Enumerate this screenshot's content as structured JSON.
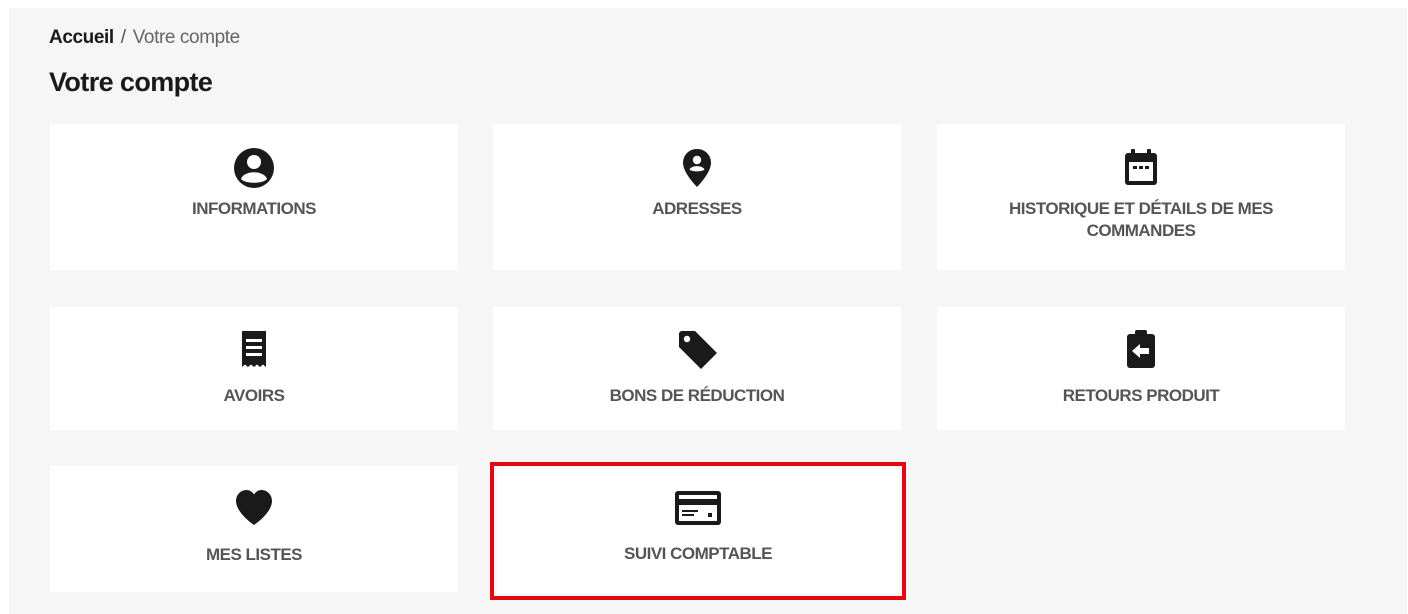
{
  "breadcrumb": {
    "home": "Accueil",
    "separator": "/",
    "current": "Votre compte"
  },
  "page": {
    "title": "Votre compte"
  },
  "tiles": [
    {
      "label": "INFORMATIONS",
      "icon": "user-circle-icon"
    },
    {
      "label": "ADRESSES",
      "icon": "map-pin-icon"
    },
    {
      "label": "HISTORIQUE ET DÉTAILS DE MES COMMANDES",
      "icon": "calendar-icon"
    },
    {
      "label": "AVOIRS",
      "icon": "receipt-icon"
    },
    {
      "label": "BONS DE RÉDUCTION",
      "icon": "tag-icon"
    },
    {
      "label": "RETOURS PRODUIT",
      "icon": "clipboard-return-icon"
    },
    {
      "label": "MES LISTES",
      "icon": "heart-icon"
    },
    {
      "label": "SUIVI COMPTABLE",
      "icon": "credit-card-icon",
      "highlighted": true
    }
  ],
  "colors": {
    "background": "#f6f6f6",
    "tile": "#ffffff",
    "highlight": "#e30613",
    "icon": "#1a1a1a",
    "label": "#555555"
  }
}
